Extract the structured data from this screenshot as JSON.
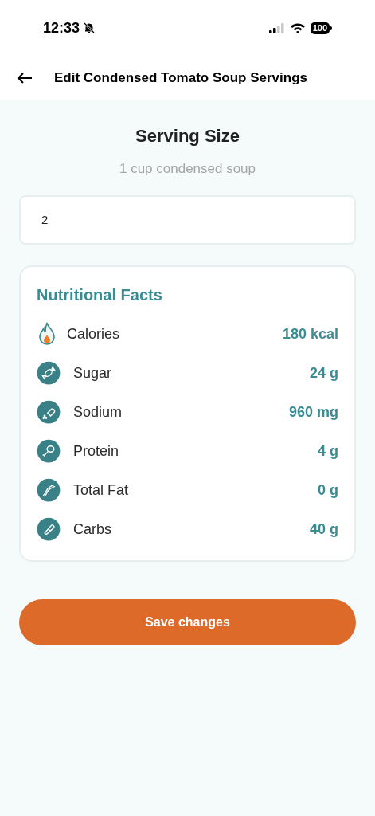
{
  "status_bar": {
    "time": "12:33",
    "battery": "100"
  },
  "header": {
    "title": "Edit Condensed Tomato Soup Servings"
  },
  "serving": {
    "title": "Serving Size",
    "unit": "1 cup condensed soup",
    "value": "2"
  },
  "facts": {
    "title": "Nutritional Facts",
    "items": [
      {
        "kind": "calories",
        "label": "Calories",
        "value": "180 kcal"
      },
      {
        "kind": "sugar",
        "label": "Sugar",
        "value": "24 g"
      },
      {
        "kind": "sodium",
        "label": "Sodium",
        "value": "960 mg"
      },
      {
        "kind": "protein",
        "label": "Protein",
        "value": "4 g"
      },
      {
        "kind": "fat",
        "label": "Total Fat",
        "value": "0 g"
      },
      {
        "kind": "carbs",
        "label": "Carbs",
        "value": "40 g"
      }
    ]
  },
  "save_button": "Save changes"
}
